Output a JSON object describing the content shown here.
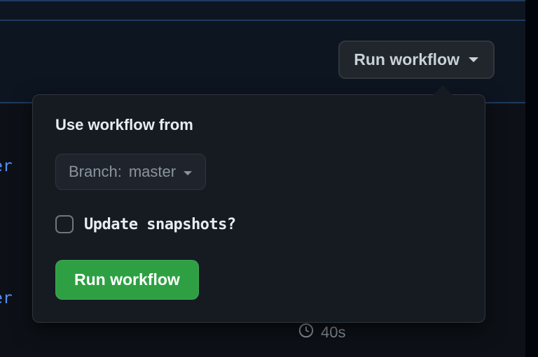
{
  "trigger": {
    "label": "Run workflow"
  },
  "panel": {
    "heading": "Use workflow from",
    "branch_prefix": "Branch:",
    "branch_name": "master",
    "checkbox_label": "Update snapshots?",
    "submit_label": "Run workflow"
  },
  "left_badges": {
    "badge1": "er",
    "badge2": "er"
  },
  "duration": {
    "value": "40s"
  }
}
